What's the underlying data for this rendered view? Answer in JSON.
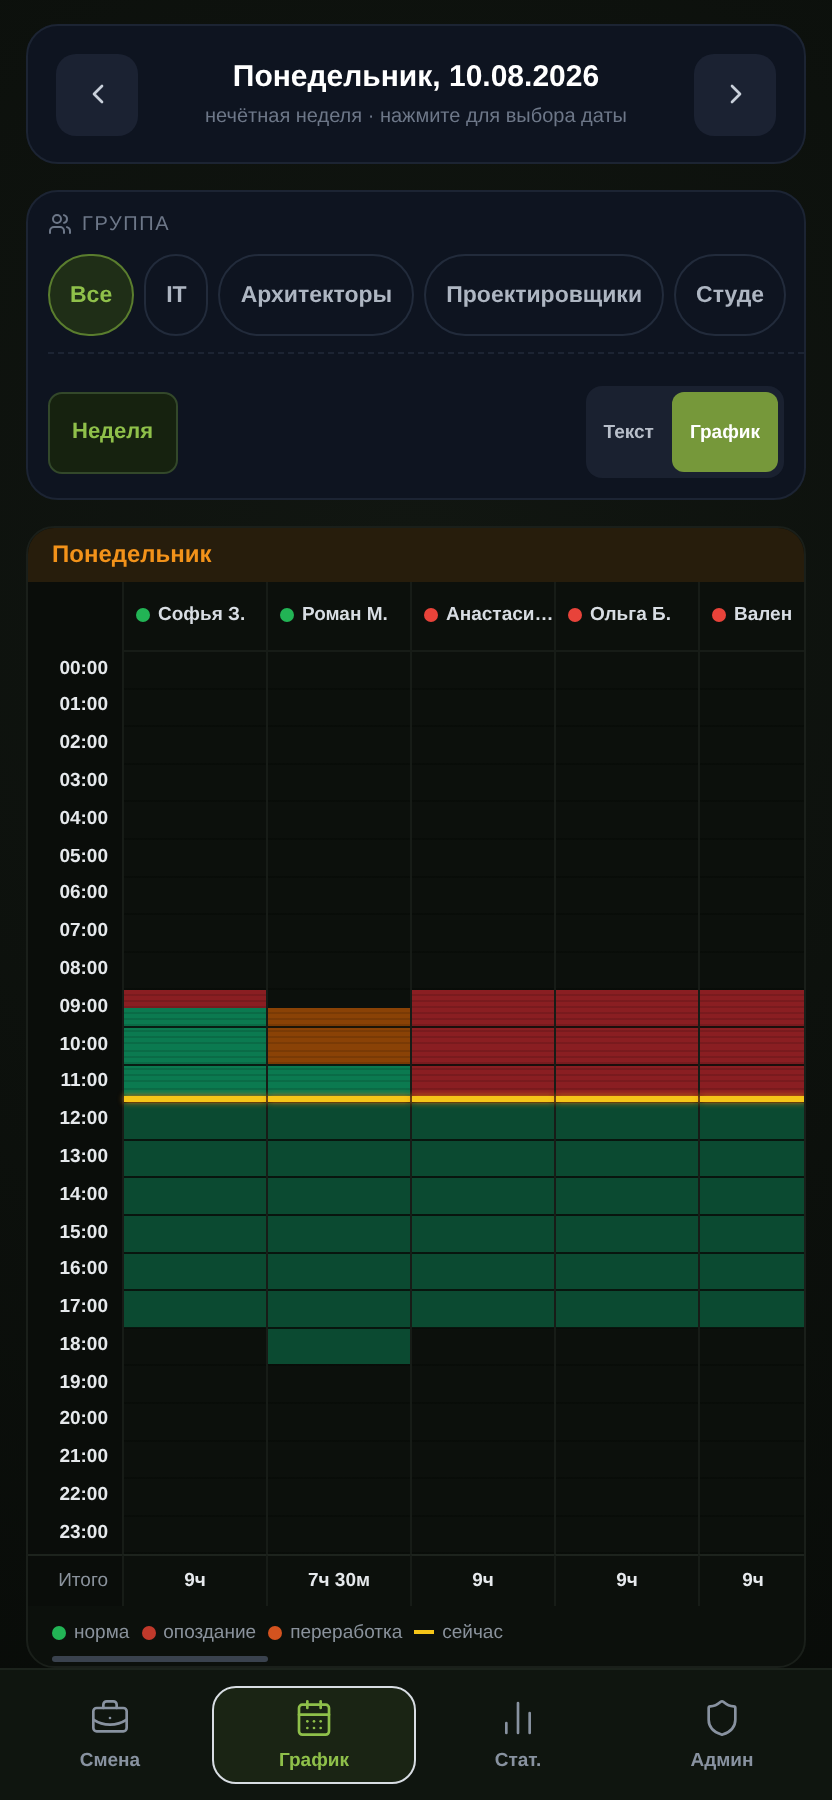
{
  "date_header": {
    "title": "Понедельник, 10.08.2026",
    "subtitle": "нечётная неделя · нажмите для выбора даты"
  },
  "group": {
    "label": "ГРУППА",
    "chips": [
      {
        "label": "Все",
        "selected": true
      },
      {
        "label": "IT",
        "selected": false
      },
      {
        "label": "Архитекторы",
        "selected": false
      },
      {
        "label": "Проектировщики",
        "selected": false
      },
      {
        "label": "Студе",
        "selected": false
      }
    ]
  },
  "week_button": {
    "label": "Неделя",
    "on": true
  },
  "view_toggle": [
    {
      "label": "Текст",
      "selected": false
    },
    {
      "label": "График",
      "selected": true
    }
  ],
  "day_panel": {
    "title": "Понедельник",
    "hours": [
      "00:00",
      "01:00",
      "02:00",
      "03:00",
      "04:00",
      "05:00",
      "06:00",
      "07:00",
      "08:00",
      "09:00",
      "10:00",
      "11:00",
      "12:00",
      "13:00",
      "14:00",
      "15:00",
      "16:00",
      "17:00",
      "18:00",
      "19:00",
      "20:00",
      "21:00",
      "22:00",
      "23:00"
    ],
    "people": [
      {
        "name": "Софья З.",
        "color": "#22b455",
        "total": "9ч",
        "half_hours": [
          {
            "kind": "off"
          },
          {
            "kind": "off"
          },
          {
            "kind": "off"
          },
          {
            "kind": "off"
          },
          {
            "kind": "off"
          },
          {
            "kind": "off"
          },
          {
            "kind": "off"
          },
          {
            "kind": "off"
          },
          {
            "kind": "off"
          },
          {
            "kind": "off"
          },
          {
            "kind": "off"
          },
          {
            "kind": "off"
          },
          {
            "kind": "off"
          },
          {
            "kind": "off"
          },
          {
            "kind": "off"
          },
          {
            "kind": "off"
          },
          {
            "kind": "off"
          },
          {
            "kind": "off"
          },
          {
            "kind": "late"
          },
          {
            "kind": "norm"
          },
          {
            "kind": "norm"
          },
          {
            "kind": "norm"
          },
          {
            "kind": "norm"
          },
          {
            "kind": "norm"
          },
          {
            "kind": "planned"
          },
          {
            "kind": "planned"
          },
          {
            "kind": "planned"
          },
          {
            "kind": "planned"
          },
          {
            "kind": "planned"
          },
          {
            "kind": "planned"
          },
          {
            "kind": "planned"
          },
          {
            "kind": "planned"
          },
          {
            "kind": "planned"
          },
          {
            "kind": "planned"
          },
          {
            "kind": "planned"
          },
          {
            "kind": "planned"
          },
          {
            "kind": "off"
          },
          {
            "kind": "off"
          },
          {
            "kind": "off"
          },
          {
            "kind": "off"
          },
          {
            "kind": "off"
          },
          {
            "kind": "off"
          },
          {
            "kind": "off"
          },
          {
            "kind": "off"
          },
          {
            "kind": "off"
          },
          {
            "kind": "off"
          },
          {
            "kind": "off"
          },
          {
            "kind": "off"
          }
        ]
      },
      {
        "name": "Роман М.",
        "color": "#22b455",
        "total": "7ч 30м",
        "half_hours": [
          {
            "kind": "off"
          },
          {
            "kind": "off"
          },
          {
            "kind": "off"
          },
          {
            "kind": "off"
          },
          {
            "kind": "off"
          },
          {
            "kind": "off"
          },
          {
            "kind": "off"
          },
          {
            "kind": "off"
          },
          {
            "kind": "off"
          },
          {
            "kind": "off"
          },
          {
            "kind": "off"
          },
          {
            "kind": "off"
          },
          {
            "kind": "off"
          },
          {
            "kind": "off"
          },
          {
            "kind": "off"
          },
          {
            "kind": "off"
          },
          {
            "kind": "off"
          },
          {
            "kind": "off"
          },
          {
            "kind": "off"
          },
          {
            "kind": "overtime"
          },
          {
            "kind": "overtime"
          },
          {
            "kind": "overtime"
          },
          {
            "kind": "norm"
          },
          {
            "kind": "norm"
          },
          {
            "kind": "planned"
          },
          {
            "kind": "planned"
          },
          {
            "kind": "planned"
          },
          {
            "kind": "planned"
          },
          {
            "kind": "planned"
          },
          {
            "kind": "planned"
          },
          {
            "kind": "planned"
          },
          {
            "kind": "planned"
          },
          {
            "kind": "planned"
          },
          {
            "kind": "planned"
          },
          {
            "kind": "planned"
          },
          {
            "kind": "planned"
          },
          {
            "kind": "planned"
          },
          {
            "kind": "planned"
          },
          {
            "kind": "off"
          },
          {
            "kind": "off"
          },
          {
            "kind": "off"
          },
          {
            "kind": "off"
          },
          {
            "kind": "off"
          },
          {
            "kind": "off"
          },
          {
            "kind": "off"
          },
          {
            "kind": "off"
          },
          {
            "kind": "off"
          },
          {
            "kind": "off"
          }
        ]
      },
      {
        "name": "Анастаси…",
        "color": "#e8433a",
        "total": "9ч",
        "half_hours": [
          {
            "kind": "off"
          },
          {
            "kind": "off"
          },
          {
            "kind": "off"
          },
          {
            "kind": "off"
          },
          {
            "kind": "off"
          },
          {
            "kind": "off"
          },
          {
            "kind": "off"
          },
          {
            "kind": "off"
          },
          {
            "kind": "off"
          },
          {
            "kind": "off"
          },
          {
            "kind": "off"
          },
          {
            "kind": "off"
          },
          {
            "kind": "off"
          },
          {
            "kind": "off"
          },
          {
            "kind": "off"
          },
          {
            "kind": "off"
          },
          {
            "kind": "off"
          },
          {
            "kind": "off"
          },
          {
            "kind": "late"
          },
          {
            "kind": "late"
          },
          {
            "kind": "late"
          },
          {
            "kind": "late"
          },
          {
            "kind": "late"
          },
          {
            "kind": "late"
          },
          {
            "kind": "planned"
          },
          {
            "kind": "planned"
          },
          {
            "kind": "planned"
          },
          {
            "kind": "planned"
          },
          {
            "kind": "planned"
          },
          {
            "kind": "planned"
          },
          {
            "kind": "planned"
          },
          {
            "kind": "planned"
          },
          {
            "kind": "planned"
          },
          {
            "kind": "planned"
          },
          {
            "kind": "planned"
          },
          {
            "kind": "planned"
          },
          {
            "kind": "off"
          },
          {
            "kind": "off"
          },
          {
            "kind": "off"
          },
          {
            "kind": "off"
          },
          {
            "kind": "off"
          },
          {
            "kind": "off"
          },
          {
            "kind": "off"
          },
          {
            "kind": "off"
          },
          {
            "kind": "off"
          },
          {
            "kind": "off"
          },
          {
            "kind": "off"
          },
          {
            "kind": "off"
          }
        ]
      },
      {
        "name": "Ольга Б.",
        "color": "#e8433a",
        "total": "9ч",
        "half_hours": [
          {
            "kind": "off"
          },
          {
            "kind": "off"
          },
          {
            "kind": "off"
          },
          {
            "kind": "off"
          },
          {
            "kind": "off"
          },
          {
            "kind": "off"
          },
          {
            "kind": "off"
          },
          {
            "kind": "off"
          },
          {
            "kind": "off"
          },
          {
            "kind": "off"
          },
          {
            "kind": "off"
          },
          {
            "kind": "off"
          },
          {
            "kind": "off"
          },
          {
            "kind": "off"
          },
          {
            "kind": "off"
          },
          {
            "kind": "off"
          },
          {
            "kind": "off"
          },
          {
            "kind": "off"
          },
          {
            "kind": "late"
          },
          {
            "kind": "late"
          },
          {
            "kind": "late"
          },
          {
            "kind": "late"
          },
          {
            "kind": "late"
          },
          {
            "kind": "late"
          },
          {
            "kind": "planned"
          },
          {
            "kind": "planned"
          },
          {
            "kind": "planned"
          },
          {
            "kind": "planned"
          },
          {
            "kind": "planned"
          },
          {
            "kind": "planned"
          },
          {
            "kind": "planned"
          },
          {
            "kind": "planned"
          },
          {
            "kind": "planned"
          },
          {
            "kind": "planned"
          },
          {
            "kind": "planned"
          },
          {
            "kind": "planned"
          },
          {
            "kind": "off"
          },
          {
            "kind": "off"
          },
          {
            "kind": "off"
          },
          {
            "kind": "off"
          },
          {
            "kind": "off"
          },
          {
            "kind": "off"
          },
          {
            "kind": "off"
          },
          {
            "kind": "off"
          },
          {
            "kind": "off"
          },
          {
            "kind": "off"
          },
          {
            "kind": "off"
          },
          {
            "kind": "off"
          }
        ]
      },
      {
        "name": "Вален",
        "color": "#e8433a",
        "total": "9ч",
        "half_hours": [
          {
            "kind": "off"
          },
          {
            "kind": "off"
          },
          {
            "kind": "off"
          },
          {
            "kind": "off"
          },
          {
            "kind": "off"
          },
          {
            "kind": "off"
          },
          {
            "kind": "off"
          },
          {
            "kind": "off"
          },
          {
            "kind": "off"
          },
          {
            "kind": "off"
          },
          {
            "kind": "off"
          },
          {
            "kind": "off"
          },
          {
            "kind": "off"
          },
          {
            "kind": "off"
          },
          {
            "kind": "off"
          },
          {
            "kind": "off"
          },
          {
            "kind": "off"
          },
          {
            "kind": "off"
          },
          {
            "kind": "late"
          },
          {
            "kind": "late"
          },
          {
            "kind": "late"
          },
          {
            "kind": "late"
          },
          {
            "kind": "late"
          },
          {
            "kind": "late"
          },
          {
            "kind": "planned"
          },
          {
            "kind": "planned"
          },
          {
            "kind": "planned"
          },
          {
            "kind": "planned"
          },
          {
            "kind": "planned"
          },
          {
            "kind": "planned"
          },
          {
            "kind": "planned"
          },
          {
            "kind": "planned"
          },
          {
            "kind": "planned"
          },
          {
            "kind": "planned"
          },
          {
            "kind": "planned"
          },
          {
            "kind": "planned"
          },
          {
            "kind": "off"
          },
          {
            "kind": "off"
          },
          {
            "kind": "off"
          },
          {
            "kind": "off"
          },
          {
            "kind": "off"
          },
          {
            "kind": "off"
          },
          {
            "kind": "off"
          },
          {
            "kind": "off"
          },
          {
            "kind": "off"
          },
          {
            "kind": "off"
          },
          {
            "kind": "off"
          },
          {
            "kind": "off"
          }
        ]
      }
    ],
    "total_label": "Итого",
    "legend": [
      {
        "kind": "dot",
        "label": "норма",
        "color": "#22b455"
      },
      {
        "kind": "dot",
        "label": "опоздание",
        "color": "#c0392b"
      },
      {
        "kind": "dot",
        "label": "переработка",
        "color": "#d4531f"
      },
      {
        "kind": "line",
        "label": "сейчас",
        "color": "#f5c518"
      }
    ]
  },
  "bottom_nav": [
    {
      "label": "Смена",
      "selected": false
    },
    {
      "label": "График",
      "selected": true
    },
    {
      "label": "Стат.",
      "selected": false
    },
    {
      "label": "Админ",
      "selected": false
    }
  ]
}
